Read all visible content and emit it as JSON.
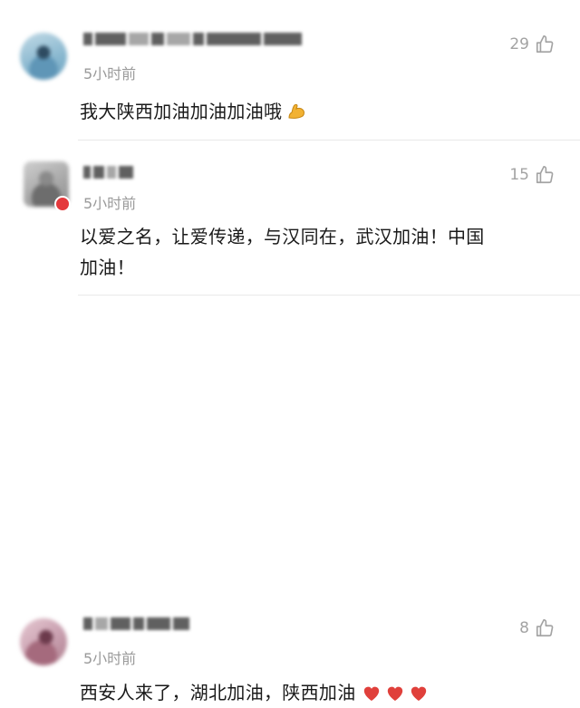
{
  "comments": [
    {
      "time": "5小时前",
      "likes": "29",
      "text": "我大陕西加油加油加油哦",
      "emoji": "flexed-biceps-icon"
    },
    {
      "time": "5小时前",
      "likes": "15",
      "text_line1": "以爱之名，让爱传递，与汉同在，武汉加油！中国",
      "text_line2": "加油！"
    },
    {
      "time": "5小时前",
      "likes": "8",
      "text": "西安人来了，湖北加油，陕西加油",
      "emoji": "red-heart-icon x3"
    }
  ],
  "colors": {
    "meta_text": "#9a9a9a",
    "like_icon": "#a3a3a3",
    "divider": "#e9e9e9",
    "heart": "#e0403b",
    "biceps": "#f2b233"
  }
}
